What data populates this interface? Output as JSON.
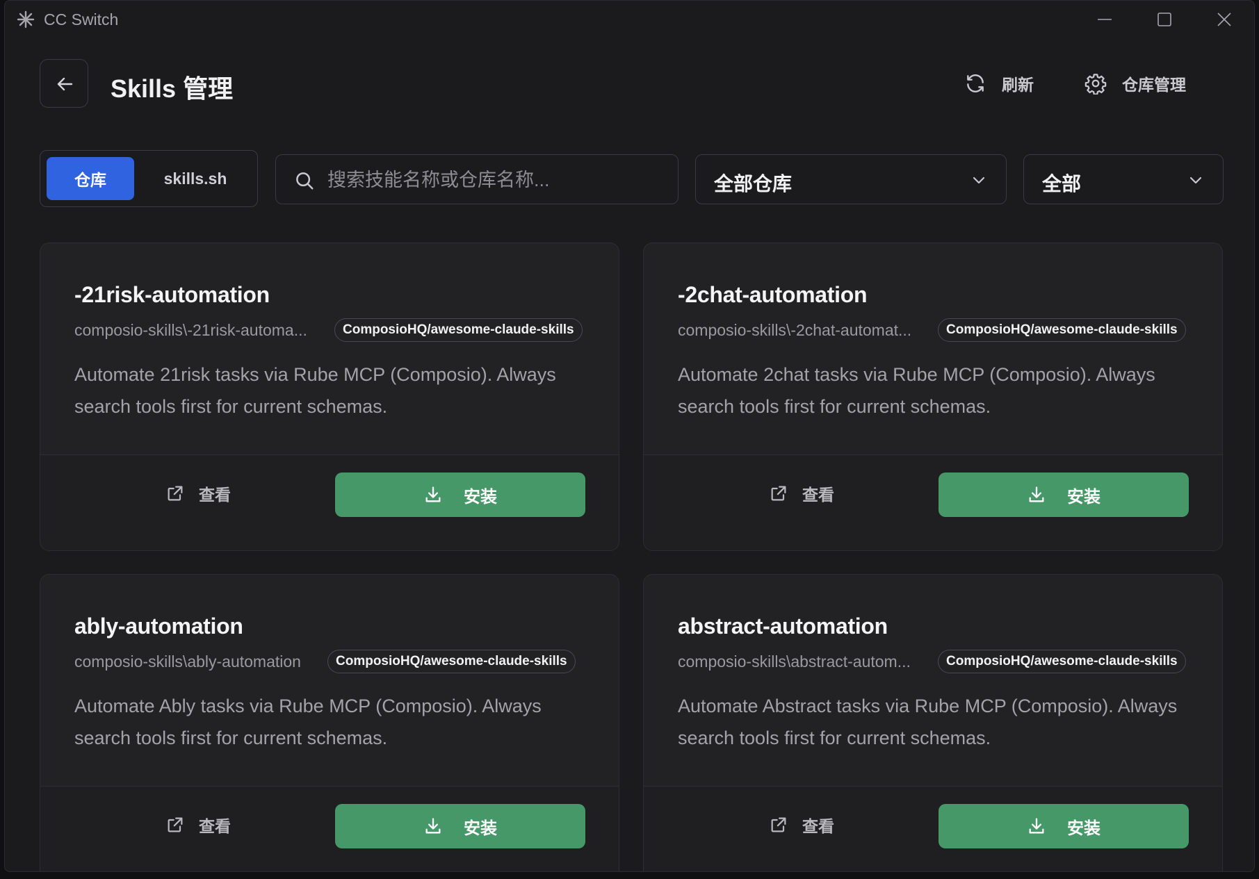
{
  "window": {
    "title": "CC Switch"
  },
  "header": {
    "title": "Skills 管理",
    "refresh_label": "刷新",
    "repo_manage_label": "仓库管理"
  },
  "filters": {
    "tabs": [
      {
        "label": "仓库",
        "active": true
      },
      {
        "label": "skills.sh",
        "active": false
      }
    ],
    "search_placeholder": "搜索技能名称或仓库名称...",
    "repo_select_value": "全部仓库",
    "status_select_value": "全部"
  },
  "cards": [
    {
      "name": "-21risk-automation",
      "path": "composio-skills\\-21risk-automa...",
      "repo": "ComposioHQ/awesome-claude-skills",
      "description": "Automate 21risk tasks via Rube MCP (Composio). Always search tools first for current schemas.",
      "view_label": "查看",
      "install_label": "安装"
    },
    {
      "name": "-2chat-automation",
      "path": "composio-skills\\-2chat-automat...",
      "repo": "ComposioHQ/awesome-claude-skills",
      "description": "Automate 2chat tasks via Rube MCP (Composio). Always search tools first for current schemas.",
      "view_label": "查看",
      "install_label": "安装"
    },
    {
      "name": "ably-automation",
      "path": "composio-skills\\ably-automation",
      "repo": "ComposioHQ/awesome-claude-skills",
      "description": "Automate Ably tasks via Rube MCP (Composio). Always search tools first for current schemas.",
      "view_label": "查看",
      "install_label": "安装"
    },
    {
      "name": "abstract-automation",
      "path": "composio-skills\\abstract-autom...",
      "repo": "ComposioHQ/awesome-claude-skills",
      "description": "Automate Abstract tasks via Rube MCP (Composio). Always search tools first for current schemas.",
      "view_label": "查看",
      "install_label": "安装"
    }
  ],
  "colors": {
    "accent_blue": "#2f63e0",
    "install_green": "#469868",
    "background": "#1b1b1d",
    "card": "#222224"
  }
}
